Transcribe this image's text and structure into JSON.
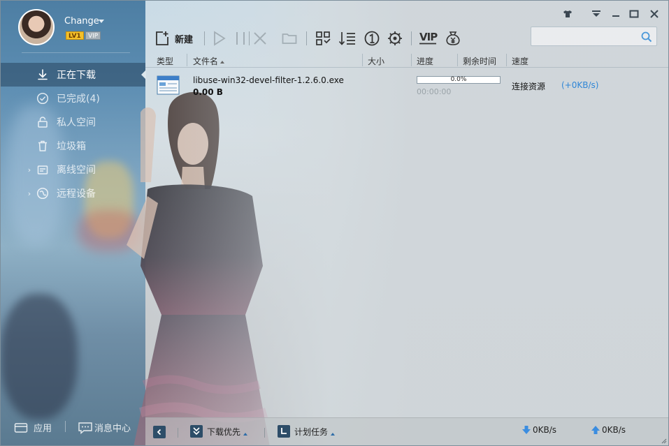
{
  "user": {
    "name": "Change",
    "level": "LV1",
    "vip": "VIP"
  },
  "nav": {
    "items": [
      {
        "label": "正在下载",
        "icon": "download-arrow-icon",
        "active": true
      },
      {
        "label": "已完成(4)",
        "icon": "check-circle-icon"
      },
      {
        "label": "私人空间",
        "icon": "lock-icon"
      },
      {
        "label": "垃圾箱",
        "icon": "trash-icon"
      },
      {
        "label": "离线空间",
        "icon": "offline-space-icon",
        "expandable": true
      },
      {
        "label": "远程设备",
        "icon": "remote-device-icon",
        "expandable": true
      }
    ]
  },
  "sidebar_bottom": {
    "apps": "应用",
    "messages": "消息中心"
  },
  "toolbar": {
    "new_label": "新建",
    "vip_label": "VIP"
  },
  "search": {
    "placeholder": ""
  },
  "columns": {
    "type": "类型",
    "filename": "文件名",
    "size": "大小",
    "progress": "进度",
    "remaining": "剩余时间",
    "speed": "速度"
  },
  "task": {
    "filename": "libuse-win32-devel-filter-1.2.6.0.exe",
    "size": "0.00 B",
    "progress_text": "0.0%",
    "progress_value": 0.0,
    "remaining": "00:00:00",
    "status": "连接资源",
    "speed": "(+0KB/s)"
  },
  "bottombar": {
    "priority": "下载优先",
    "schedule": "计划任务",
    "down_speed": "0KB/s",
    "up_speed": "0KB/s"
  },
  "colors": {
    "accent_blue": "#2f86d6",
    "sidebar_active": "#2d4d68"
  }
}
